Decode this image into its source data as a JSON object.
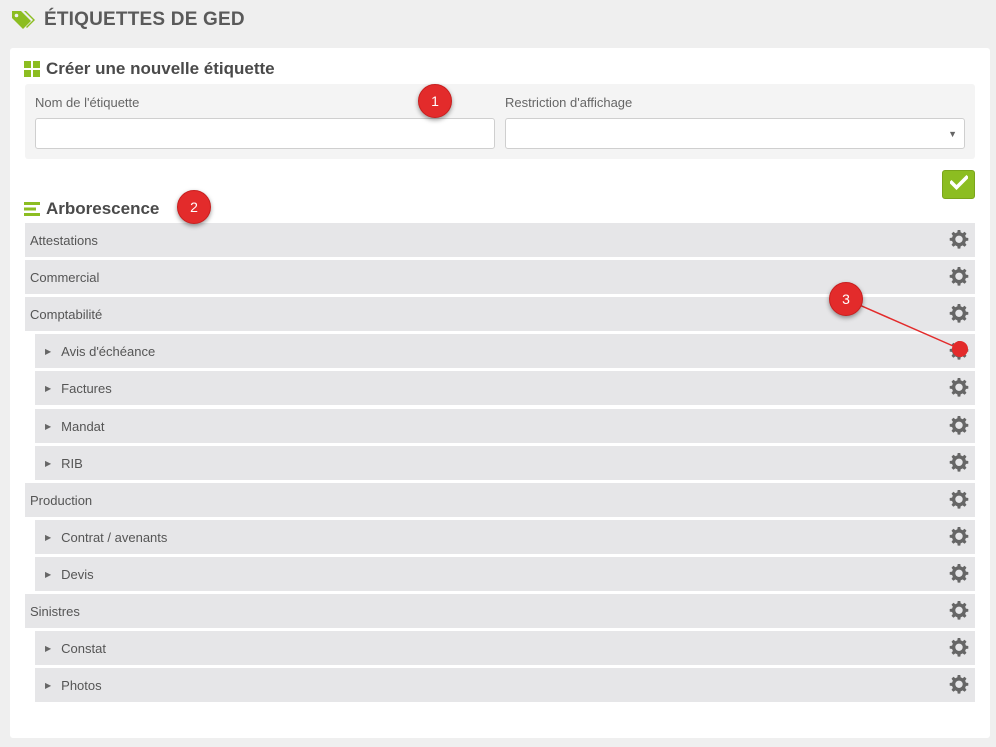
{
  "header": {
    "title": "ÉTIQUETTES DE GED",
    "icon": "tag-icon"
  },
  "create_section": {
    "title": "Créer une nouvelle étiquette",
    "icon": "grid-icon",
    "name_label": "Nom de l'étiquette",
    "name_value": "",
    "restriction_label": "Restriction d'affichage",
    "restriction_value": "",
    "confirm_icon": "check-icon"
  },
  "tree_section": {
    "title": "Arborescence",
    "icon": "bars-icon",
    "rows": [
      {
        "label": "Attestations",
        "level": 0
      },
      {
        "label": "Commercial",
        "level": 0
      },
      {
        "label": "Comptabilité",
        "level": 0
      },
      {
        "label": "Avis d'échéance",
        "level": 1
      },
      {
        "label": "Factures",
        "level": 1
      },
      {
        "label": "Mandat",
        "level": 1
      },
      {
        "label": "RIB",
        "level": 1
      },
      {
        "label": "Production",
        "level": 0
      },
      {
        "label": "Contrat / avenants",
        "level": 1
      },
      {
        "label": "Devis",
        "level": 1
      },
      {
        "label": "Sinistres",
        "level": 0
      },
      {
        "label": "Constat",
        "level": 1
      },
      {
        "label": "Photos",
        "level": 1
      }
    ]
  },
  "annotations": [
    "1",
    "2",
    "3"
  ],
  "colors": {
    "accent_green": "#8cbd21",
    "annotation_red": "#e32b2b",
    "row_bg": "#e6e6e8",
    "gear": "#666666"
  }
}
